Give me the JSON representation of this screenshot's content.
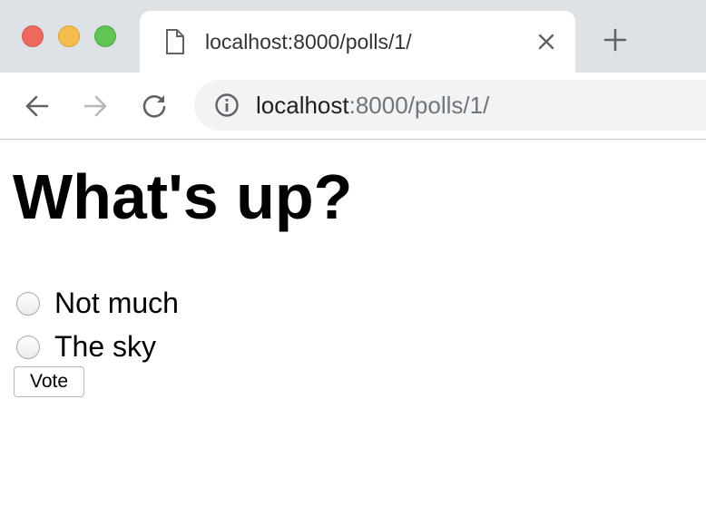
{
  "window": {
    "controls": [
      "close",
      "minimize",
      "maximize"
    ],
    "colors": {
      "close": "#ed6a5e",
      "minimize": "#f5bf4f",
      "maximize": "#61c554"
    }
  },
  "tab": {
    "title": "localhost:8000/polls/1/",
    "icon": "document-icon"
  },
  "toolbar": {
    "url_host": "localhost",
    "url_rest": ":8000/polls/1/"
  },
  "poll": {
    "question": "What's up?",
    "choices": [
      {
        "label": "Not much",
        "selected": false
      },
      {
        "label": "The sky",
        "selected": false
      }
    ],
    "vote_label": "Vote"
  }
}
